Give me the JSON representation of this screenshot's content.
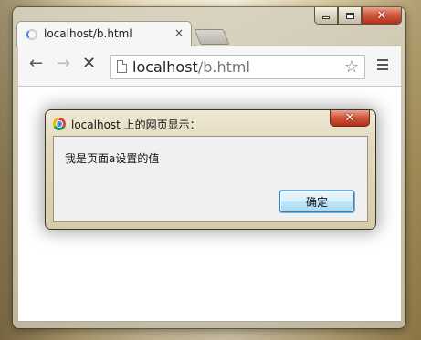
{
  "browser": {
    "tab": {
      "title": "localhost/b.html",
      "close_glyph": "×"
    },
    "toolbar": {
      "back_icon": "back-arrow-icon",
      "forward_icon": "forward-arrow-icon",
      "stop_icon": "stop-icon",
      "url_host": "localhost",
      "url_path": "/b.html",
      "bookmark_icon": "star-icon",
      "menu_icon": "hamburger-menu-icon"
    },
    "window_controls": [
      "minimize",
      "maximize",
      "close"
    ]
  },
  "alert_dialog": {
    "title": "localhost 上的网页显示：",
    "message": "我是页面a设置的值",
    "ok_label": "确定",
    "close_glyph": "x"
  },
  "colors": {
    "close_button": "#d15a3d",
    "ok_button_border": "#3c7fb1",
    "loading_spinner": "#4a7fd6"
  }
}
